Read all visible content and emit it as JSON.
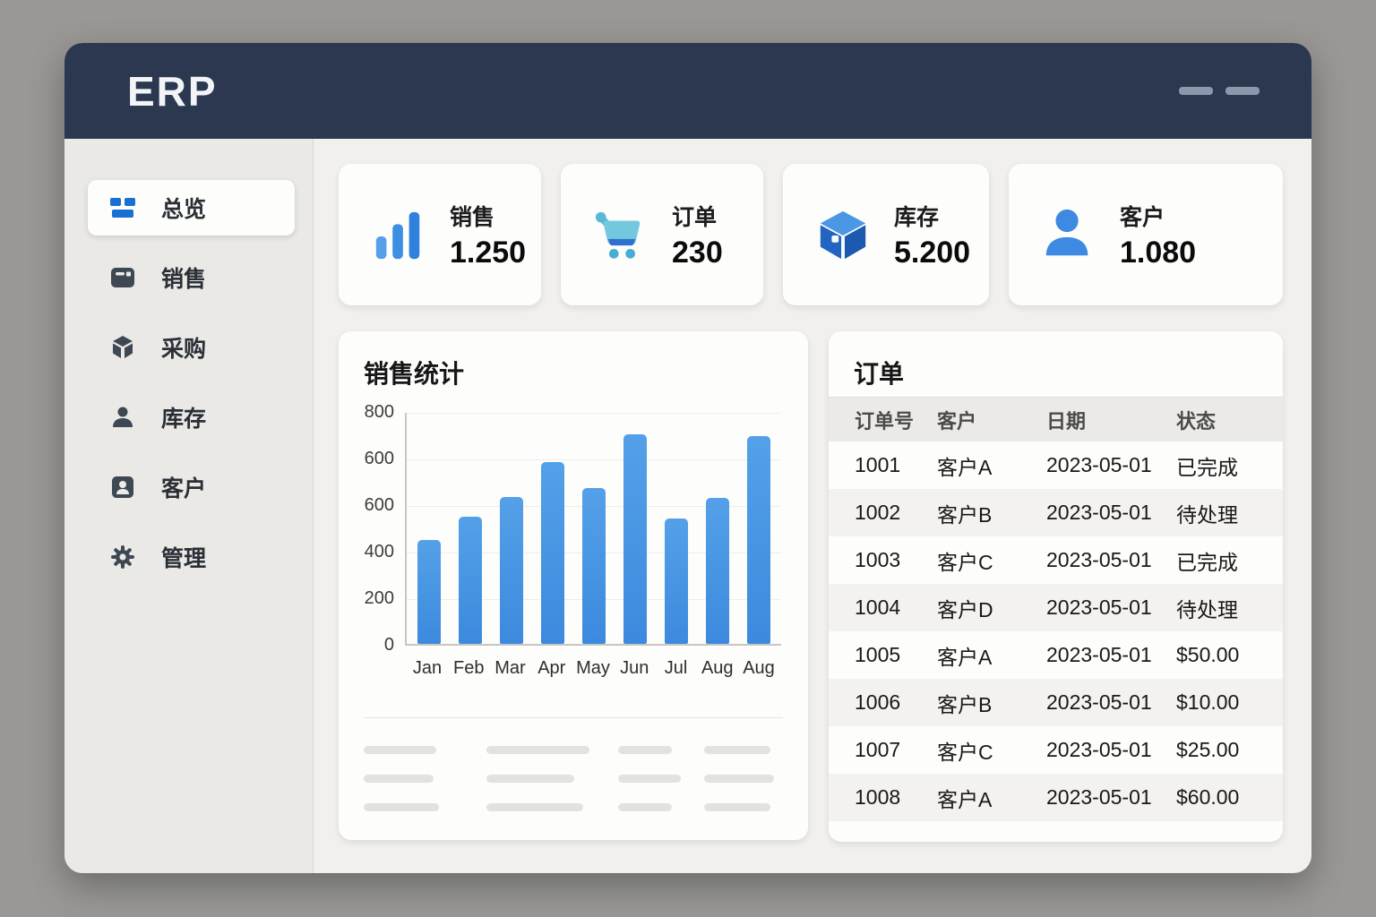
{
  "window": {
    "logo": "ERP",
    "backdrop_color": "#999894",
    "header_color": "#2b384f",
    "accent_blue": "#1a6fd3",
    "bar_blue": "#4494e4"
  },
  "sidebar": {
    "items": [
      {
        "label": "总览",
        "icon": "dashboard-icon",
        "active": true
      },
      {
        "label": "销售",
        "icon": "sales-icon",
        "active": false
      },
      {
        "label": "采购",
        "icon": "procurement-icon",
        "active": false
      },
      {
        "label": "库存",
        "icon": "inventory-icon",
        "active": false
      },
      {
        "label": "客户",
        "icon": "customers-icon",
        "active": false
      },
      {
        "label": "管理",
        "icon": "settings-icon",
        "active": false
      }
    ]
  },
  "stats": [
    {
      "label": "销售",
      "value": "1.250",
      "icon": "bar-chart-icon"
    },
    {
      "label": "订单",
      "value": "230",
      "icon": "cart-icon"
    },
    {
      "label": "库存",
      "value": "5.200",
      "icon": "cube-icon"
    },
    {
      "label": "客户",
      "value": "1.080",
      "icon": "user-icon"
    }
  ],
  "chart_data": {
    "type": "bar",
    "title": "销售统计",
    "categories": [
      "Jan",
      "Feb",
      "Mar",
      "Apr",
      "May",
      "Jun",
      "Jul",
      "Aug",
      "Aug"
    ],
    "values": [
      360,
      440,
      510,
      630,
      540,
      725,
      435,
      505,
      720
    ],
    "ylim": [
      0,
      800
    ],
    "y_tick_labels": [
      "800",
      "600",
      "600",
      "400",
      "200",
      "0"
    ],
    "grid": true,
    "legend": false,
    "bar_color": "#4494e4"
  },
  "orders": {
    "title": "订单",
    "columns": [
      "订单号",
      "客户",
      "日期",
      "状态"
    ],
    "rows": [
      [
        "1001",
        "客户A",
        "2023-05-01",
        "已完成"
      ],
      [
        "1002",
        "客户B",
        "2023-05-01",
        "待处理"
      ],
      [
        "1003",
        "客户C",
        "2023-05-01",
        "已完成"
      ],
      [
        "1004",
        "客户D",
        "2023-05-01",
        "待处理"
      ],
      [
        "1005",
        "客户A",
        "2023-05-01",
        "$50.00"
      ],
      [
        "1006",
        "客户B",
        "2023-05-01",
        "$10.00"
      ],
      [
        "1007",
        "客户C",
        "2023-05-01",
        "$25.00"
      ],
      [
        "1008",
        "客户A",
        "2023-05-01",
        "$60.00"
      ]
    ]
  }
}
